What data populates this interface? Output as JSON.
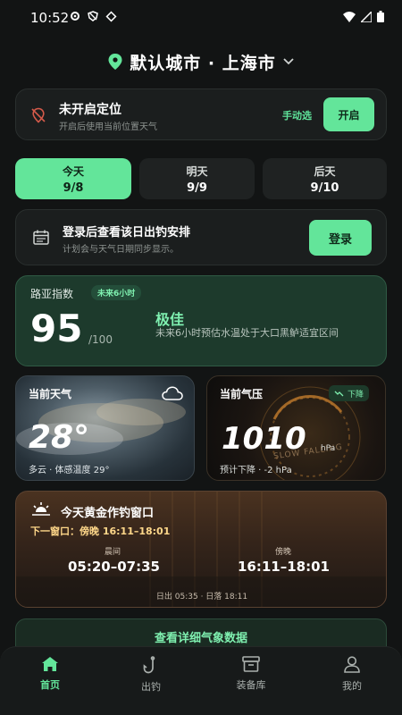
{
  "status": {
    "time": "10:52"
  },
  "header": {
    "city": "默认城市 · 上海市"
  },
  "location": {
    "title": "未开启定位",
    "subtitle": "开启后使用当前位置天气",
    "manual": "手动选",
    "enable": "开启"
  },
  "days": [
    {
      "label": "今天",
      "date": "9/8"
    },
    {
      "label": "明天",
      "date": "9/9"
    },
    {
      "label": "后天",
      "date": "9/10"
    }
  ],
  "login": {
    "title": "登录后查看该日出钓安排",
    "subtitle": "计划会与天气日期同步显示。",
    "button": "登录"
  },
  "lure": {
    "title": "路亚指数",
    "badge": "未来6小时",
    "score": "95",
    "max": "/100",
    "level": "极佳",
    "desc": "未来6小时预估水温处于大口黑鲈适宜区间"
  },
  "weather": {
    "label": "当前天气",
    "temp": "28°",
    "sub": "多云 · 体感温度 29°",
    "icon": "cloud-icon"
  },
  "pressure": {
    "label": "当前气压",
    "trend": "下降",
    "value": "1010",
    "unit": "hPa",
    "sub": "预计下降 · -2 hPa",
    "watermark": "SLOW FALLING"
  },
  "golden": {
    "title": "今天黄金作钓窗口",
    "next": "下一窗口：傍晚 16:11–18:01",
    "morning_label": "晨间",
    "morning_time": "05:20–07:35",
    "evening_label": "傍晚",
    "evening_time": "16:11–18:01",
    "sun": "日出 05:35 · 日落 18:11"
  },
  "details": {
    "label": "查看详细气象数据"
  },
  "nav": [
    {
      "label": "首页",
      "icon": "home-icon"
    },
    {
      "label": "出钓",
      "icon": "fishhook-icon"
    },
    {
      "label": "装备库",
      "icon": "box-icon"
    },
    {
      "label": "我的",
      "icon": "user-icon"
    }
  ],
  "colors": {
    "accent": "#63e59a",
    "background": "#121414"
  }
}
